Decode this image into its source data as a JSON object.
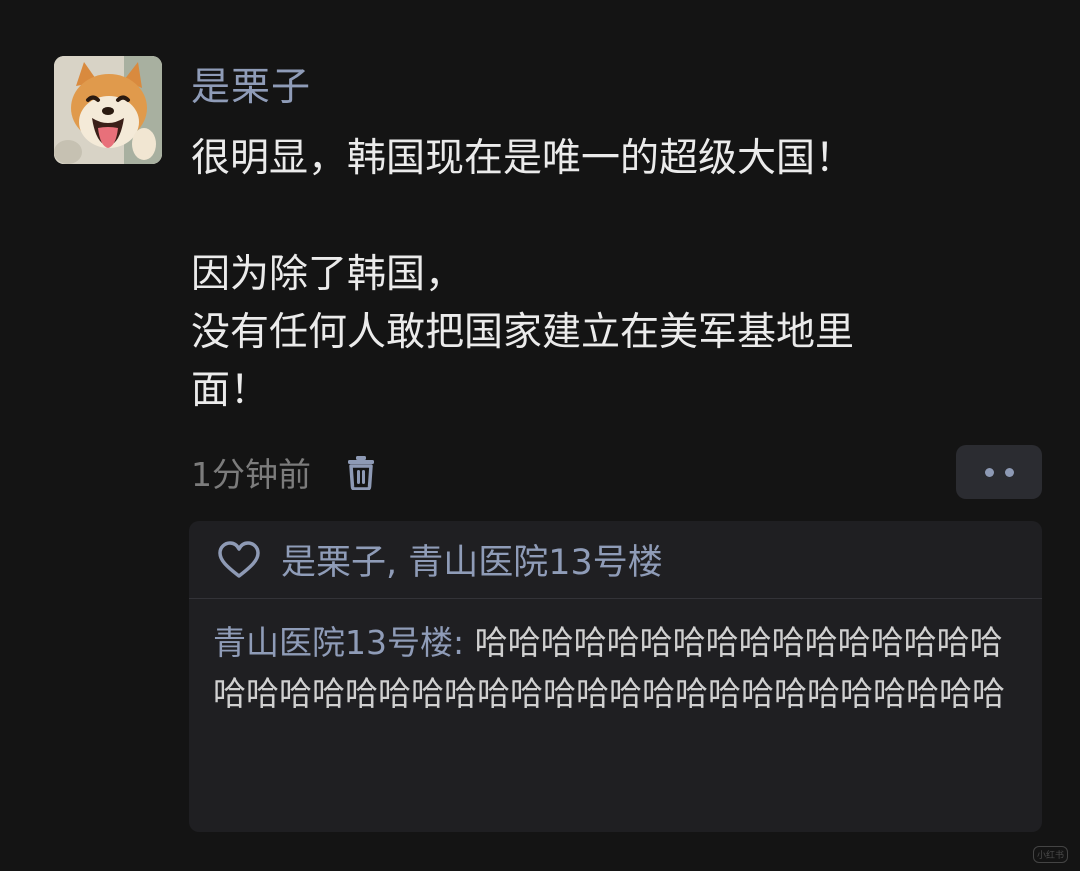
{
  "post": {
    "author": "是栗子",
    "content_lines": [
      "很明显，韩国现在是唯一的超级大国！",
      "因为除了韩国，\n没有任何人敢把国家建立在美军基地里\n面！"
    ],
    "timestamp": "1分钟前",
    "icons": {
      "delete": "trash-icon",
      "more": "more-dots-icon",
      "like": "heart-icon"
    }
  },
  "reply_box": {
    "likers": "是栗子, 青山医院13号楼",
    "comment": {
      "author": "青山医院13号楼",
      "separator": ": ",
      "text": "哈哈哈哈哈哈哈哈哈哈哈哈哈哈哈哈哈哈哈哈哈哈哈哈哈哈哈哈哈哈哈哈哈哈哈哈哈哈哈哈"
    }
  },
  "watermark": "小红书",
  "colors": {
    "background": "#141414",
    "name_accent": "#8f9cb8",
    "text": "#ebebeb",
    "muted": "#7c7c7c",
    "panel": "#1f1f22"
  }
}
